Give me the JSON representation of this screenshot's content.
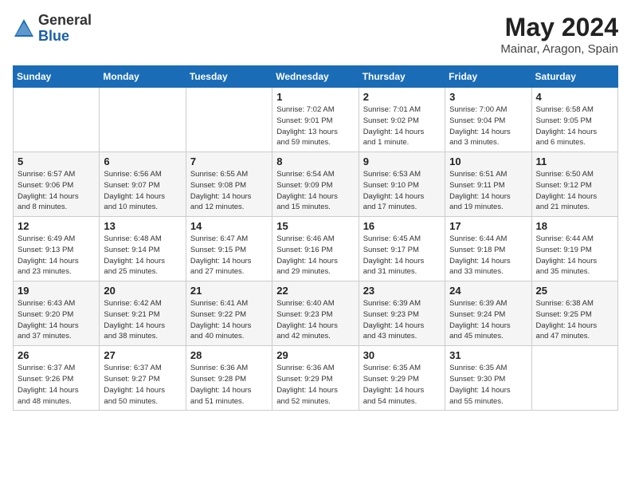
{
  "header": {
    "logo_general": "General",
    "logo_blue": "Blue",
    "month_year": "May 2024",
    "location": "Mainar, Aragon, Spain"
  },
  "days_of_week": [
    "Sunday",
    "Monday",
    "Tuesday",
    "Wednesday",
    "Thursday",
    "Friday",
    "Saturday"
  ],
  "weeks": [
    [
      {
        "num": "",
        "info": ""
      },
      {
        "num": "",
        "info": ""
      },
      {
        "num": "",
        "info": ""
      },
      {
        "num": "1",
        "info": "Sunrise: 7:02 AM\nSunset: 9:01 PM\nDaylight: 13 hours\nand 59 minutes."
      },
      {
        "num": "2",
        "info": "Sunrise: 7:01 AM\nSunset: 9:02 PM\nDaylight: 14 hours\nand 1 minute."
      },
      {
        "num": "3",
        "info": "Sunrise: 7:00 AM\nSunset: 9:04 PM\nDaylight: 14 hours\nand 3 minutes."
      },
      {
        "num": "4",
        "info": "Sunrise: 6:58 AM\nSunset: 9:05 PM\nDaylight: 14 hours\nand 6 minutes."
      }
    ],
    [
      {
        "num": "5",
        "info": "Sunrise: 6:57 AM\nSunset: 9:06 PM\nDaylight: 14 hours\nand 8 minutes."
      },
      {
        "num": "6",
        "info": "Sunrise: 6:56 AM\nSunset: 9:07 PM\nDaylight: 14 hours\nand 10 minutes."
      },
      {
        "num": "7",
        "info": "Sunrise: 6:55 AM\nSunset: 9:08 PM\nDaylight: 14 hours\nand 12 minutes."
      },
      {
        "num": "8",
        "info": "Sunrise: 6:54 AM\nSunset: 9:09 PM\nDaylight: 14 hours\nand 15 minutes."
      },
      {
        "num": "9",
        "info": "Sunrise: 6:53 AM\nSunset: 9:10 PM\nDaylight: 14 hours\nand 17 minutes."
      },
      {
        "num": "10",
        "info": "Sunrise: 6:51 AM\nSunset: 9:11 PM\nDaylight: 14 hours\nand 19 minutes."
      },
      {
        "num": "11",
        "info": "Sunrise: 6:50 AM\nSunset: 9:12 PM\nDaylight: 14 hours\nand 21 minutes."
      }
    ],
    [
      {
        "num": "12",
        "info": "Sunrise: 6:49 AM\nSunset: 9:13 PM\nDaylight: 14 hours\nand 23 minutes."
      },
      {
        "num": "13",
        "info": "Sunrise: 6:48 AM\nSunset: 9:14 PM\nDaylight: 14 hours\nand 25 minutes."
      },
      {
        "num": "14",
        "info": "Sunrise: 6:47 AM\nSunset: 9:15 PM\nDaylight: 14 hours\nand 27 minutes."
      },
      {
        "num": "15",
        "info": "Sunrise: 6:46 AM\nSunset: 9:16 PM\nDaylight: 14 hours\nand 29 minutes."
      },
      {
        "num": "16",
        "info": "Sunrise: 6:45 AM\nSunset: 9:17 PM\nDaylight: 14 hours\nand 31 minutes."
      },
      {
        "num": "17",
        "info": "Sunrise: 6:44 AM\nSunset: 9:18 PM\nDaylight: 14 hours\nand 33 minutes."
      },
      {
        "num": "18",
        "info": "Sunrise: 6:44 AM\nSunset: 9:19 PM\nDaylight: 14 hours\nand 35 minutes."
      }
    ],
    [
      {
        "num": "19",
        "info": "Sunrise: 6:43 AM\nSunset: 9:20 PM\nDaylight: 14 hours\nand 37 minutes."
      },
      {
        "num": "20",
        "info": "Sunrise: 6:42 AM\nSunset: 9:21 PM\nDaylight: 14 hours\nand 38 minutes."
      },
      {
        "num": "21",
        "info": "Sunrise: 6:41 AM\nSunset: 9:22 PM\nDaylight: 14 hours\nand 40 minutes."
      },
      {
        "num": "22",
        "info": "Sunrise: 6:40 AM\nSunset: 9:23 PM\nDaylight: 14 hours\nand 42 minutes."
      },
      {
        "num": "23",
        "info": "Sunrise: 6:39 AM\nSunset: 9:23 PM\nDaylight: 14 hours\nand 43 minutes."
      },
      {
        "num": "24",
        "info": "Sunrise: 6:39 AM\nSunset: 9:24 PM\nDaylight: 14 hours\nand 45 minutes."
      },
      {
        "num": "25",
        "info": "Sunrise: 6:38 AM\nSunset: 9:25 PM\nDaylight: 14 hours\nand 47 minutes."
      }
    ],
    [
      {
        "num": "26",
        "info": "Sunrise: 6:37 AM\nSunset: 9:26 PM\nDaylight: 14 hours\nand 48 minutes."
      },
      {
        "num": "27",
        "info": "Sunrise: 6:37 AM\nSunset: 9:27 PM\nDaylight: 14 hours\nand 50 minutes."
      },
      {
        "num": "28",
        "info": "Sunrise: 6:36 AM\nSunset: 9:28 PM\nDaylight: 14 hours\nand 51 minutes."
      },
      {
        "num": "29",
        "info": "Sunrise: 6:36 AM\nSunset: 9:29 PM\nDaylight: 14 hours\nand 52 minutes."
      },
      {
        "num": "30",
        "info": "Sunrise: 6:35 AM\nSunset: 9:29 PM\nDaylight: 14 hours\nand 54 minutes."
      },
      {
        "num": "31",
        "info": "Sunrise: 6:35 AM\nSunset: 9:30 PM\nDaylight: 14 hours\nand 55 minutes."
      },
      {
        "num": "",
        "info": ""
      }
    ]
  ]
}
